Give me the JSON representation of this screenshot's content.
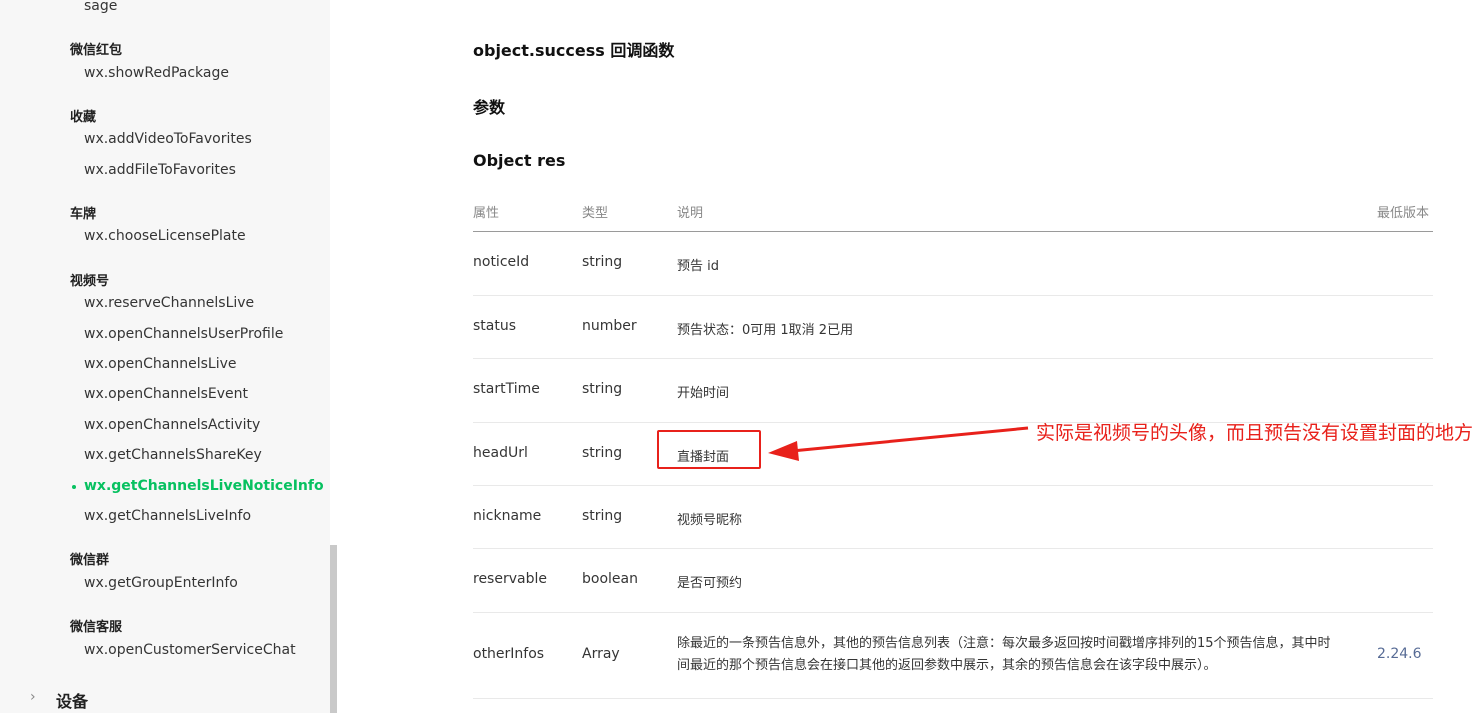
{
  "sidebar": {
    "top_partial": "sage",
    "groups": [
      {
        "title": "微信红包",
        "items": [
          "wx.showRedPackage"
        ]
      },
      {
        "title": "收藏",
        "items": [
          "wx.addVideoToFavorites",
          "wx.addFileToFavorites"
        ]
      },
      {
        "title": "车牌",
        "items": [
          "wx.chooseLicensePlate"
        ]
      },
      {
        "title": "视频号",
        "items": [
          "wx.reserveChannelsLive",
          "wx.openChannelsUserProfile",
          "wx.openChannelsLive",
          "wx.openChannelsEvent",
          "wx.openChannelsActivity",
          "wx.getChannelsShareKey",
          "wx.getChannelsLiveNoticeInfo",
          "wx.getChannelsLiveInfo"
        ]
      },
      {
        "title": "微信群",
        "items": [
          "wx.getGroupEnterInfo"
        ]
      },
      {
        "title": "微信客服",
        "items": [
          "wx.openCustomerServiceChat"
        ]
      }
    ],
    "active_item": "wx.getChannelsLiveNoticeInfo",
    "section": {
      "chevron": "›",
      "label": "设备"
    }
  },
  "main": {
    "heading_callback": "object.success 回调函数",
    "heading_params": "参数",
    "heading_object": "Object res",
    "table": {
      "headers": [
        "属性",
        "类型",
        "说明",
        "最低版本"
      ],
      "rows": [
        {
          "prop": "noticeId",
          "type": "string",
          "desc": "预告 id",
          "version": ""
        },
        {
          "prop": "status",
          "type": "number",
          "desc": "预告状态：0可用 1取消 2已用",
          "version": ""
        },
        {
          "prop": "startTime",
          "type": "string",
          "desc": "开始时间",
          "version": ""
        },
        {
          "prop": "headUrl",
          "type": "string",
          "desc": "直播封面",
          "version": ""
        },
        {
          "prop": "nickname",
          "type": "string",
          "desc": "视频号昵称",
          "version": ""
        },
        {
          "prop": "reservable",
          "type": "boolean",
          "desc": "是否可预约",
          "version": ""
        },
        {
          "prop": "otherInfos",
          "type": "Array",
          "desc": "除最近的一条预告信息外，其他的预告信息列表（注意：每次最多返回按时间戳增序排列的15个预告信息，其中时间最近的那个预告信息会在接口其他的返回参数中展示，其余的预告信息会在该字段中展示）。",
          "version": "2.24.6"
        }
      ]
    }
  },
  "annotation": {
    "text": "实际是视频号的头像，而且预告没有设置封面的地方",
    "color": "#e8211b"
  },
  "colors": {
    "accent_green": "#07c160",
    "link_blue": "#576b95",
    "sidebar_bg": "#f7f7f7"
  }
}
